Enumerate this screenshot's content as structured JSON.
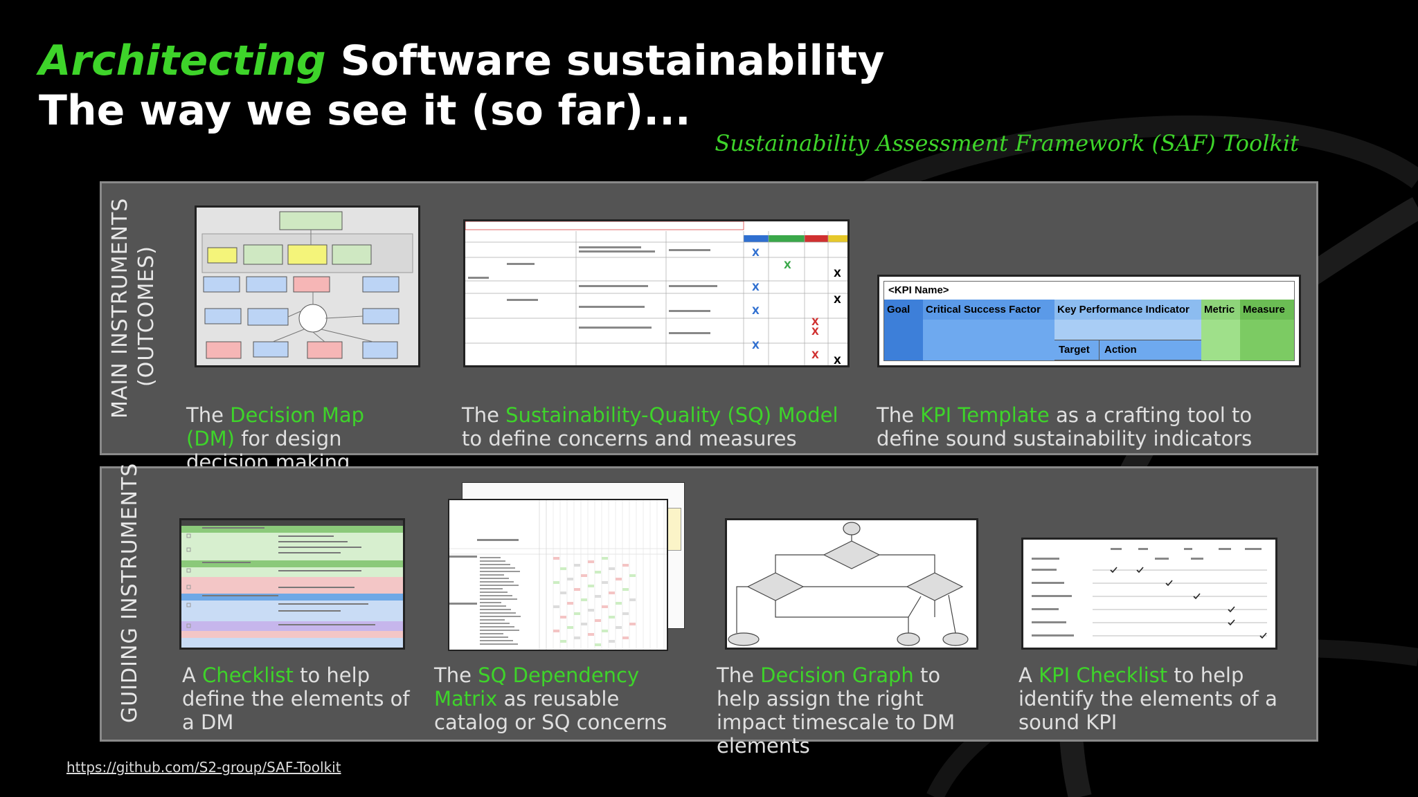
{
  "title": {
    "line1_accent": "Architecting",
    "line1_rest": " Software sustainability",
    "line2": "The way we see it (so far)..."
  },
  "toolkit_label": "Sustainability Assessment Framework (SAF) Toolkit",
  "main_panel": {
    "label_line1": "MAIN INSTRUMENTS",
    "label_line2": "(OUTCOMES)",
    "items": [
      {
        "pre": "The ",
        "highlight": "Decision Map (DM)",
        "post": " for design decision making"
      },
      {
        "pre": "The ",
        "highlight": "Sustainability-Quality (SQ) Model",
        "post": " to define concerns and measures"
      },
      {
        "pre": "The ",
        "highlight": "KPI Template",
        "post": " as a crafting tool to define sound sustainability indicators"
      }
    ],
    "kpi_template": {
      "name": "<KPI Name>",
      "headers": [
        "Goal",
        "Critical Success Factor",
        "Key Performance Indicator",
        "Metric",
        "Measure"
      ],
      "sub_headers": [
        "Target",
        "Action"
      ]
    }
  },
  "guide_panel": {
    "label": "GUIDING INSTRUMENTS",
    "items": [
      {
        "pre": "A ",
        "highlight": "Checklist",
        "post": " to help define the elements of a DM"
      },
      {
        "pre": "The ",
        "highlight": "SQ Dependency Matrix",
        "post": " as reusable catalog or SQ concerns"
      },
      {
        "pre": "The ",
        "highlight": "Decision Graph",
        "post": " to help assign the right impact timescale to DM elements"
      },
      {
        "pre": "A ",
        "highlight": "KPI Checklist",
        "post": " to help identify the elements of a sound KPI"
      }
    ]
  },
  "url": "https://github.com/S2-group/SAF-Toolkit",
  "colors": {
    "accent": "#3ed42a",
    "panel": "#545454",
    "background": "#000000"
  }
}
